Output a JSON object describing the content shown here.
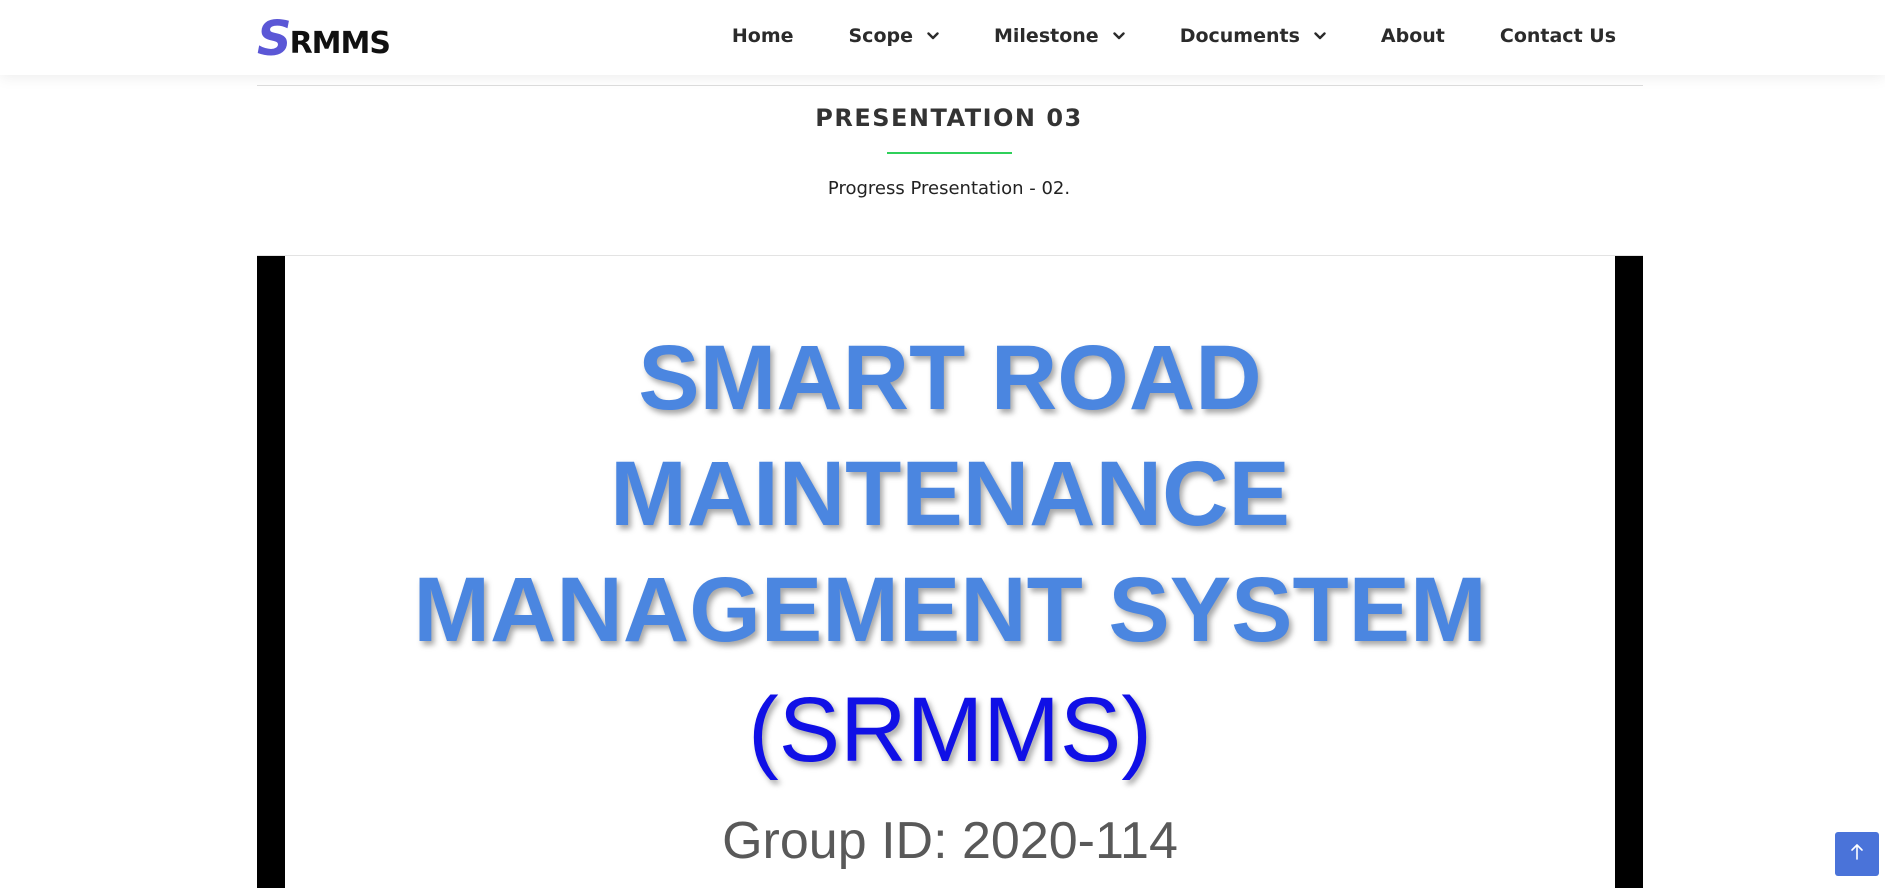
{
  "brand": {
    "logo_initial": "S",
    "logo_rest": "RMMS",
    "accent_color": "#5b57d6"
  },
  "nav": {
    "items": [
      {
        "label": "Home",
        "has_dropdown": false
      },
      {
        "label": "Scope",
        "has_dropdown": true
      },
      {
        "label": "Milestone",
        "has_dropdown": true
      },
      {
        "label": "Documents",
        "has_dropdown": true
      },
      {
        "label": "About",
        "has_dropdown": false
      },
      {
        "label": "Contact Us",
        "has_dropdown": false
      }
    ],
    "dropdown_icon": "chevron-down-icon"
  },
  "section": {
    "title": "PRESENTATION 03",
    "subtitle": "Progress Presentation - 02.",
    "underline_color": "#2fd05a"
  },
  "slide": {
    "title_lines": [
      "SMART ROAD",
      "MAINTENANCE",
      "MANAGEMENT SYSTEM"
    ],
    "acronym": "(SRMMS)",
    "group_id": "Group ID: 2020-114",
    "title_color": "#4b86e0",
    "acronym_color": "#1010e6"
  },
  "back_to_top": {
    "icon": "arrow-up-icon",
    "color": "#4a73d9"
  }
}
